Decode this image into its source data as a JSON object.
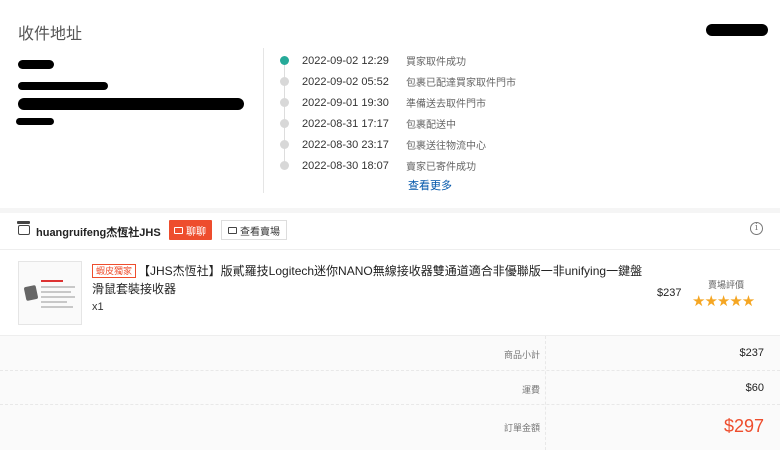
{
  "address": {
    "title": "收件地址"
  },
  "timeline": [
    {
      "time": "2022-09-02 12:29",
      "status": "買家取件成功",
      "active": true
    },
    {
      "time": "2022-09-02 05:52",
      "status": "包裹已配達買家取件門市",
      "active": false
    },
    {
      "time": "2022-09-01 19:30",
      "status": "準備送去取件門市",
      "active": false
    },
    {
      "time": "2022-08-31 17:17",
      "status": "包裹配送中",
      "active": false
    },
    {
      "time": "2022-08-30 23:17",
      "status": "包裹送往物流中心",
      "active": false
    },
    {
      "time": "2022-08-30 18:07",
      "status": "賣家已寄件成功",
      "active": false
    }
  ],
  "see_more": "查看更多",
  "shop": {
    "name": "huangruifeng杰恆社JHS",
    "chat_label": "聊聊",
    "view_shop_label": "查看賣場",
    "info_icon": "i"
  },
  "product": {
    "tag": "蝦皮獨家",
    "title": "【JHS杰恆社】版貳羅技Logitech迷你NANO無線接收器雙通道適合非優聯版一非unifying一鍵盤滑鼠套裝接收器",
    "qty": "x1",
    "price": "$237",
    "rating_label": "賣場評價",
    "stars": "★★★★★"
  },
  "summary": {
    "subtotal_label": "商品小計",
    "subtotal_value": "$237",
    "shipping_label": "運費",
    "shipping_value": "$60",
    "total_label": "訂單金額",
    "total_value": "$297"
  },
  "colors": {
    "accent": "#ee4d2d",
    "timeline_active": "#26aa99",
    "link": "#0055aa",
    "star": "#f5a623"
  }
}
